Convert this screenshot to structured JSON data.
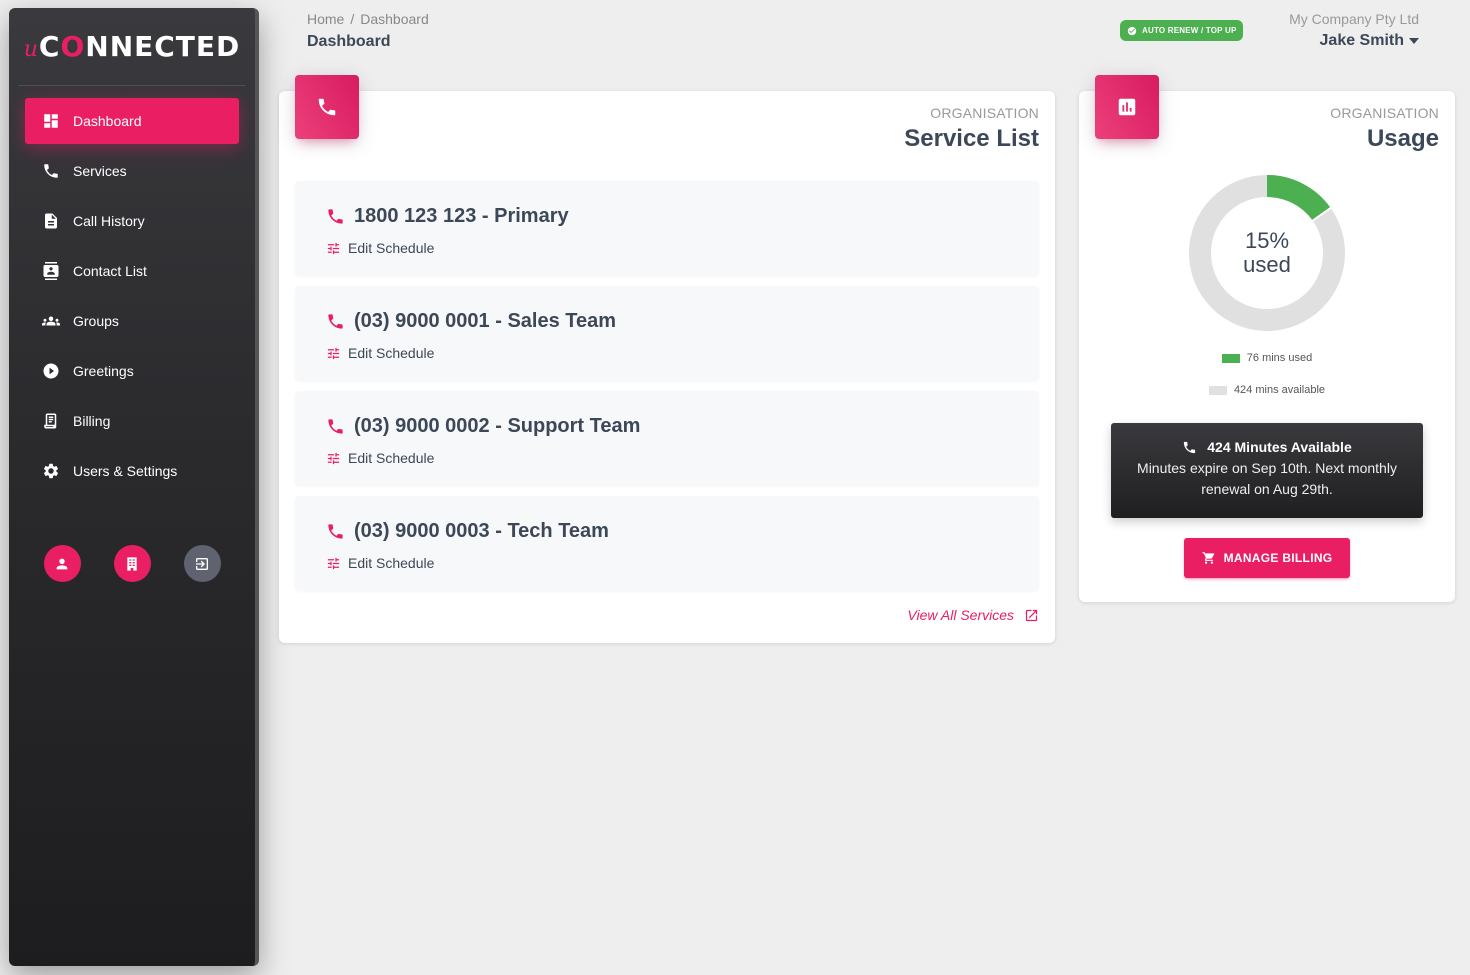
{
  "sidebar": {
    "logo": {
      "prefix": "u",
      "c": "C",
      "o": "O",
      "rest": "NNECTED"
    },
    "items": [
      {
        "label": "Dashboard",
        "icon": "dashboard-icon",
        "active": true
      },
      {
        "label": "Services",
        "icon": "phone-icon"
      },
      {
        "label": "Call History",
        "icon": "document-icon"
      },
      {
        "label": "Contact List",
        "icon": "contact-card-icon"
      },
      {
        "label": "Groups",
        "icon": "groups-icon"
      },
      {
        "label": "Greetings",
        "icon": "play-circle-icon"
      },
      {
        "label": "Billing",
        "icon": "receipt-icon"
      },
      {
        "label": "Users & Settings",
        "icon": "gear-icon"
      }
    ],
    "quick_actions": [
      "user-icon",
      "building-icon",
      "logout-icon"
    ]
  },
  "header": {
    "breadcrumb": [
      "Home",
      "Dashboard"
    ],
    "title": "Dashboard",
    "badge": "AUTO RENEW / TOP UP",
    "company": "My Company Pty Ltd",
    "user": "Jake Smith"
  },
  "service_card": {
    "category": "ORGANISATION",
    "title": "Service List",
    "services": [
      {
        "name": "1800 123 123 - Primary",
        "action": "Edit Schedule"
      },
      {
        "name": "(03) 9000 0001 - Sales Team",
        "action": "Edit Schedule"
      },
      {
        "name": "(03) 9000 0002 - Support Team",
        "action": "Edit Schedule"
      },
      {
        "name": "(03) 9000 0003 - Tech Team",
        "action": "Edit Schedule"
      }
    ],
    "view_all": "View All Services"
  },
  "usage_card": {
    "category": "ORGANISATION",
    "title": "Usage",
    "percent_label": "15%",
    "used_label": "used",
    "used_fraction": 0.152,
    "legend_used": "76 mins used",
    "legend_available": "424 mins available",
    "minutes_heading": "424 Minutes Available",
    "minutes_body": "Minutes expire on Sep 10th. Next monthly renewal on Aug 29th.",
    "manage_billing": "MANAGE BILLING"
  },
  "colors": {
    "accent": "#e91e63",
    "used": "#4caf50",
    "available": "#e0e0e0",
    "badge": "#4caf50"
  }
}
